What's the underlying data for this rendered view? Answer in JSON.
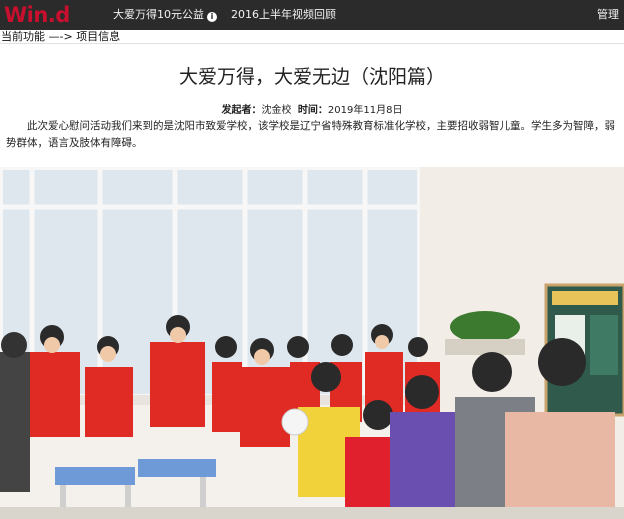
{
  "header": {
    "logo_text": "Win.d",
    "nav": [
      "大爱万得10元公益",
      "2016上半年视频回顾"
    ],
    "admin_label": "管理"
  },
  "breadcrumb": {
    "current_label": "当前功能",
    "arrow": "—->",
    "page": "项目信息"
  },
  "article": {
    "title": "大爱万得，大爱无边（沈阳篇）",
    "initiator_label": "发起者：",
    "initiator": "沈金校",
    "time_label": "时间：",
    "time": "2019年11月8日",
    "body": "此次爱心慰问活动我们来到的是沈阳市致爱学校，该学校是辽宁省特殊教育标准化学校，主要招收弱智儿童。学生多为智障，弱势群体，语言及肢体有障碍。"
  },
  "colors": {
    "topbar": "#2b2b2b",
    "logo": "#c8102e",
    "vest": "#e02a24"
  }
}
